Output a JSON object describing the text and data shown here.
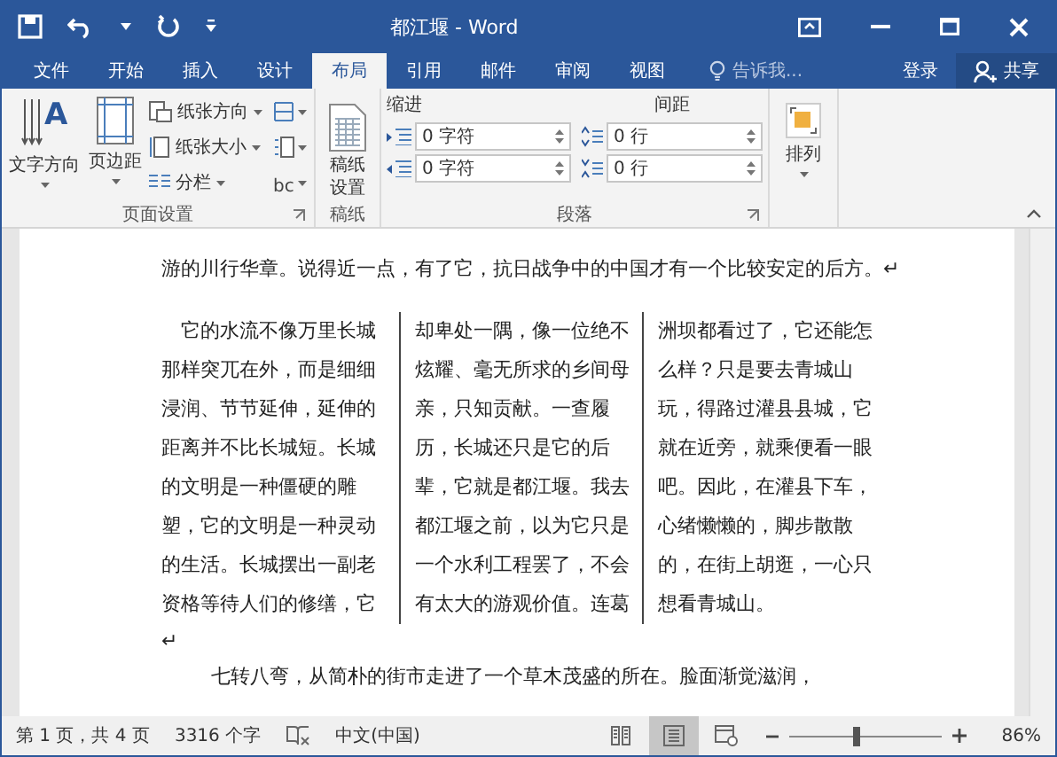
{
  "title_bar": {
    "title": "都江堰 - Word"
  },
  "tabs": [
    {
      "label": "文件",
      "selected": false
    },
    {
      "label": "开始",
      "selected": false
    },
    {
      "label": "插入",
      "selected": false
    },
    {
      "label": "设计",
      "selected": false
    },
    {
      "label": "布局",
      "selected": true
    },
    {
      "label": "引用",
      "selected": false
    },
    {
      "label": "邮件",
      "selected": false
    },
    {
      "label": "审阅",
      "selected": false
    },
    {
      "label": "视图",
      "selected": false
    }
  ],
  "tell_me": {
    "placeholder": "告诉我..."
  },
  "sign_in": "登录",
  "share": "共享",
  "ribbon": {
    "page_setup": {
      "label": "页面设置",
      "text_direction": "文字方向",
      "text_direction_icon_letter": "A",
      "hyphenation_icon_text": "bc",
      "margins": "页边距",
      "orientation": "纸张方向",
      "size": "纸张大小",
      "columns": "分栏"
    },
    "manuscript": {
      "label": "稿纸",
      "button": "稿纸设置"
    },
    "paragraph": {
      "label": "段落",
      "indent_label": "缩进",
      "spacing_label": "间距",
      "indent_left": "0 字符",
      "indent_right": "0 字符",
      "spacing_before": "0 行",
      "spacing_after": "0 行"
    },
    "arrange": {
      "button": "排列"
    }
  },
  "document": {
    "intro_line": "游的川行华章。说得近一点，有了它，抗日战争中的中国才有一个比较安定的后方。↵",
    "columns": [
      {
        "first_line_indent": true,
        "lines": [
          "它的水流不像万里长城",
          "那样突兀在外，而是细细",
          "浸润、节节延伸，延伸的",
          "距离并不比长城短。长城",
          "的文明是一种僵硬的雕",
          "塑，它的文明是一种灵动",
          "的生活。长城摆出一副老",
          "资格等待人们的修缮，它"
        ]
      },
      {
        "first_line_indent": false,
        "lines": [
          "却卑处一隅，像一位绝不",
          "炫耀、毫无所求的乡间母",
          "亲，只知贡献。一查履",
          "历，长城还只是它的后",
          "辈，它就是都江堰。我去",
          "都江堰之前，以为它只是",
          "一个水利工程罢了，不会",
          "有太大的游观价值。连葛"
        ]
      },
      {
        "first_line_indent": false,
        "lines": [
          "洲坝都看过了，它还能怎",
          "么样？只是要去青城山",
          "玩，得路过灌县县城，它",
          "就在近旁，就乘便看一眼",
          "吧。因此，在灌县下车，",
          "心绪懒懒的，脚步散散",
          "的，在街上胡逛，一心只",
          "想看青城山。"
        ]
      }
    ],
    "column_end_mark": "↵",
    "next_line": "七转八弯，从简朴的街市走进了一个草木茂盛的所在。脸面渐觉滋润，"
  },
  "status_bar": {
    "page": "第 1 页，共 4 页",
    "words": "3316 个字",
    "language": "中文(中国)",
    "views": [
      {
        "kind": "read",
        "selected": false
      },
      {
        "kind": "print",
        "selected": true
      },
      {
        "kind": "web",
        "selected": false
      }
    ],
    "zoom": {
      "level": 0.45,
      "reading": "86%"
    }
  }
}
